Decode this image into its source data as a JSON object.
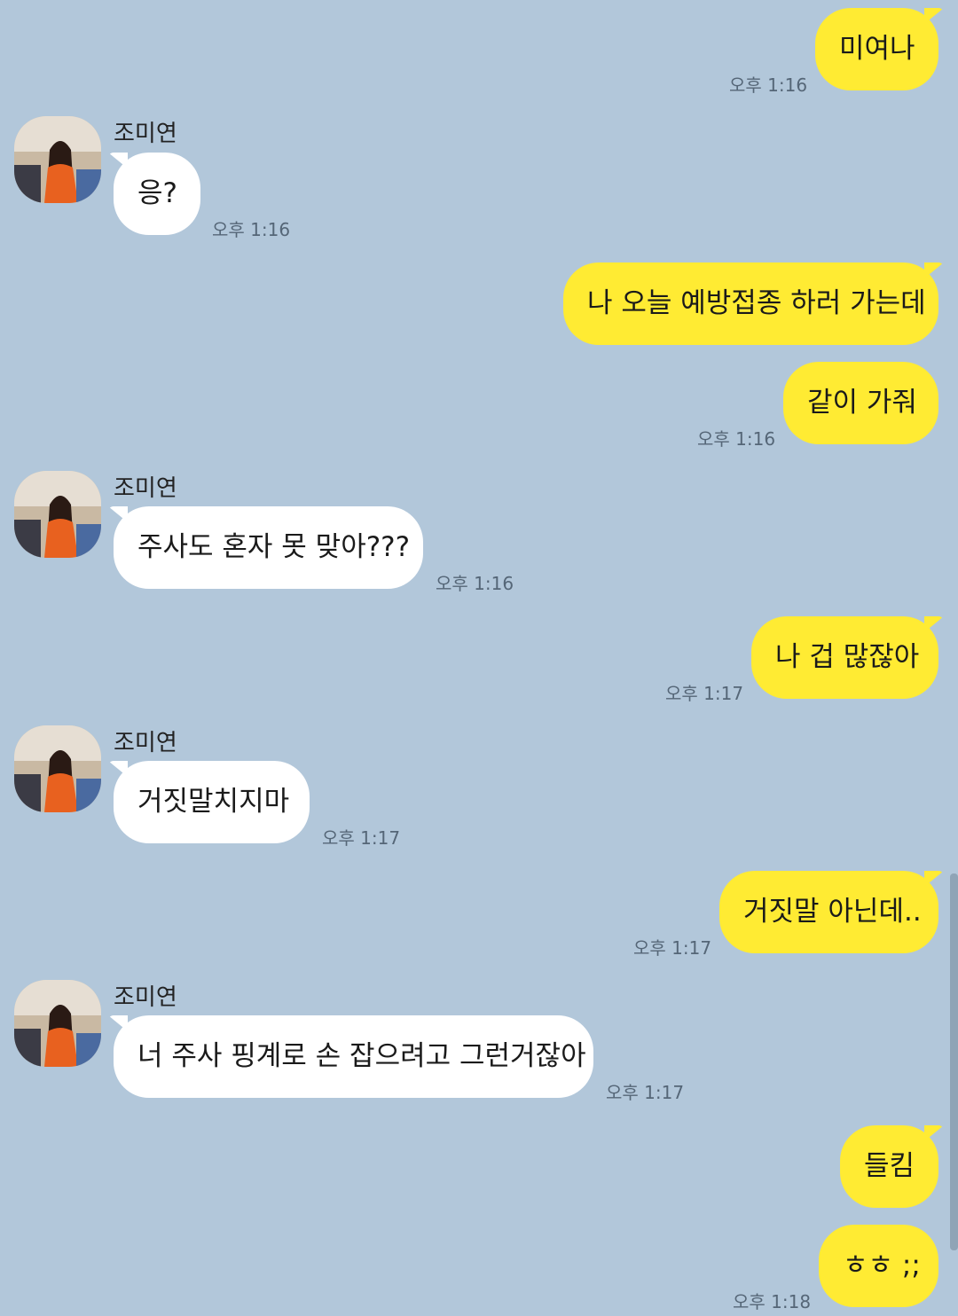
{
  "contact": {
    "name": "조미연"
  },
  "messages": [
    {
      "dir": "out",
      "text": "미여나",
      "time": "오후 1:16"
    },
    {
      "dir": "in",
      "text": "응?",
      "time": "오후 1:16"
    },
    {
      "dir": "out",
      "text": "나 오늘 예방접종 하러 가는데"
    },
    {
      "dir": "out",
      "text": "같이 가줘",
      "time": "오후 1:16"
    },
    {
      "dir": "in",
      "text": "주사도 혼자 못 맞아???",
      "time": "오후 1:16"
    },
    {
      "dir": "out",
      "text": "나 겁 많잖아",
      "time": "오후 1:17"
    },
    {
      "dir": "in",
      "text": "거짓말치지마",
      "time": "오후 1:17"
    },
    {
      "dir": "out",
      "text": "거짓말 아닌데..",
      "time": "오후 1:17"
    },
    {
      "dir": "in",
      "text": "너 주사 핑계로 손 잡으려고 그런거잖아",
      "time": "오후 1:17"
    },
    {
      "dir": "out",
      "text": "들킴"
    },
    {
      "dir": "out",
      "text": "ㅎㅎ ;;",
      "time": "오후 1:18"
    }
  ],
  "colors": {
    "background": "#b2c7da",
    "outgoing": "#ffeb33",
    "incoming": "#ffffff"
  }
}
